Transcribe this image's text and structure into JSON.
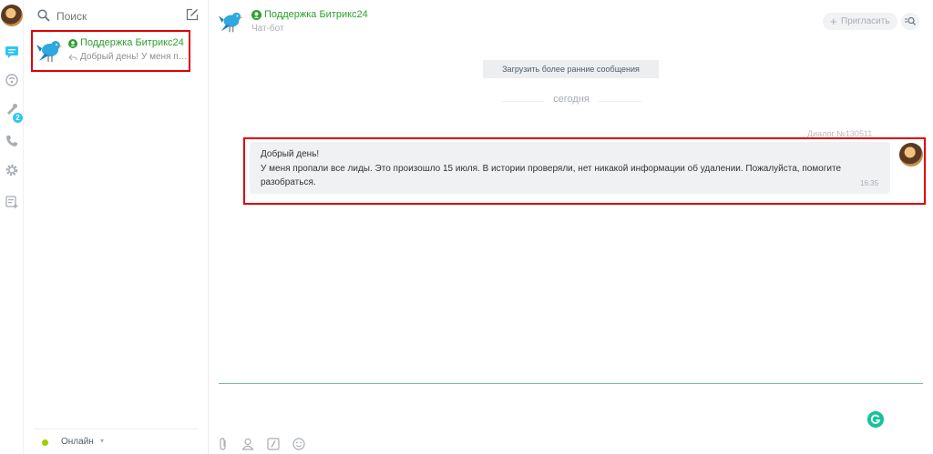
{
  "sidebar": {
    "search_placeholder": "Поиск",
    "notification_badge": "2",
    "recent_chats": [
      {
        "name": "Поддержка Битрикс24",
        "preview": "Добрый день! У меня проп..."
      }
    ],
    "status_label": "Онлайн"
  },
  "dialog": {
    "title": "Поддержка Битрикс24",
    "subtitle": "Чат-бот",
    "invite_label": "Пригласить",
    "load_earlier_label": "Загрузить более ранние сообщения",
    "day_separator": "сегодня",
    "dialog_number": "Диалог №130511",
    "message": {
      "lines": [
        "Добрый день!",
        "У меня пропали все лиды. Это произошло 15 июля. В истории проверяли, нет никакой информации об удалении. Пожалуйста, помогите",
        "разобраться."
      ],
      "time": "16:35"
    }
  },
  "colors": {
    "accent_green": "#2ca02c",
    "highlight_red": "#e00000",
    "online_green": "#9dcf00",
    "badge_blue": "#2fc6f6"
  },
  "icons": {
    "rail": [
      "user-avatar",
      "chat-icon",
      "openlines-icon",
      "notifications-icon",
      "phone-icon",
      "settings-icon",
      "add-list-icon"
    ],
    "composer": [
      "attach-icon",
      "user-icon",
      "command-icon",
      "smile-icon"
    ]
  }
}
